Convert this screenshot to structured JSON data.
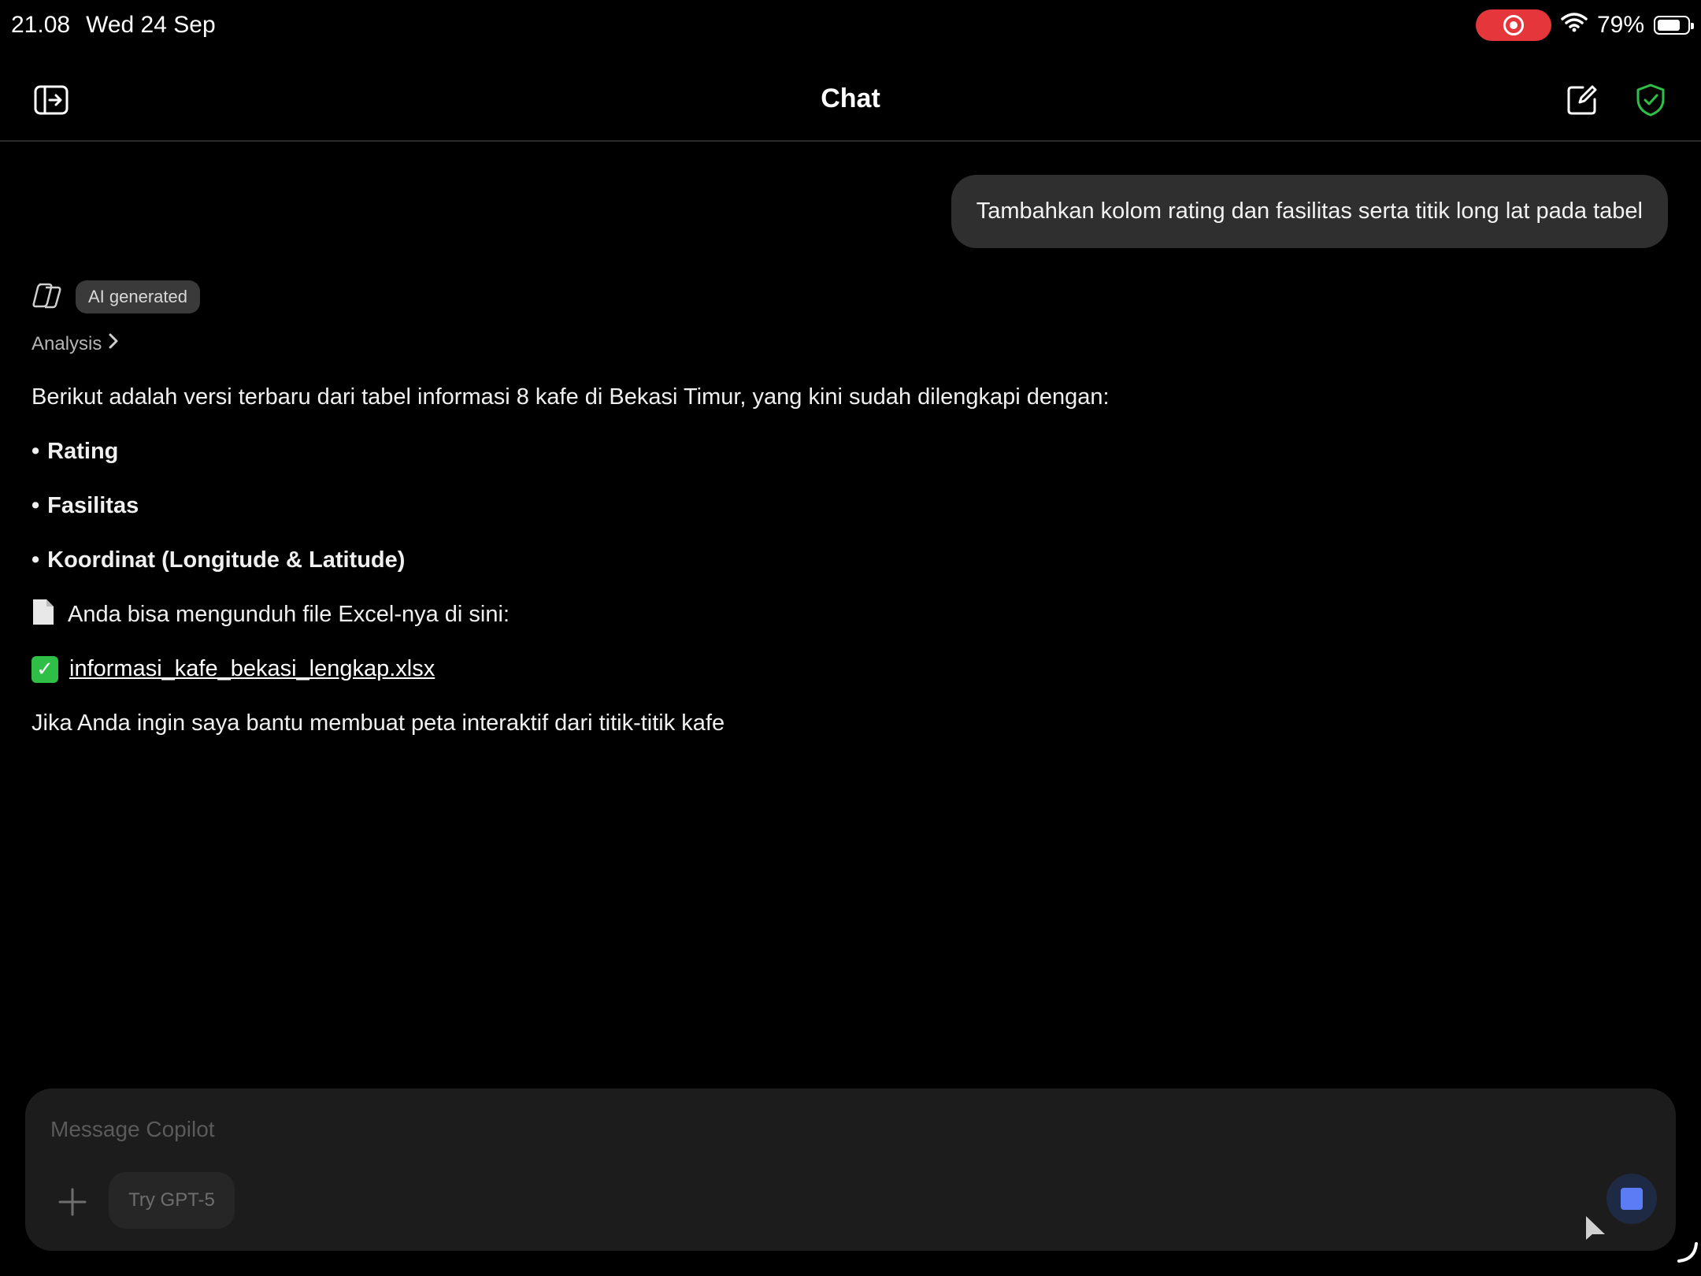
{
  "status_bar": {
    "time": "21.08",
    "date": "Wed 24 Sep",
    "battery_percent": "79%",
    "battery_level": 0.79,
    "recording": true,
    "recording_color": "#e5363c"
  },
  "header": {
    "title": "Chat",
    "left_icon": "sidebar-toggle-icon",
    "right_icons": [
      "new-chat-icon",
      "shield-check-icon"
    ],
    "shield_color": "#2fbf46"
  },
  "conversation": {
    "user_message": "Tambahkan kolom rating dan fasilitas serta titik long lat pada tabel",
    "ai": {
      "badge": "AI generated",
      "analysis_label": "Analysis",
      "intro": "Berikut adalah versi terbaru dari tabel informasi 8 kafe di Bekasi Timur, yang kini sudah dilengkapi dengan:",
      "bullets": [
        "Rating",
        "Fasilitas",
        "Koordinat (Longitude & Latitude)"
      ],
      "download_text": "Anda bisa mengunduh file Excel-nya di sini:",
      "file_link": "informasi_kafe_bekasi_lengkap.xlsx",
      "closing": "Jika Anda ingin saya bantu membuat peta interaktif dari titik-titik kafe"
    }
  },
  "composer": {
    "placeholder": "Message Copilot",
    "try_button": "Try GPT-5",
    "stop_color": "#5b7cf5"
  }
}
